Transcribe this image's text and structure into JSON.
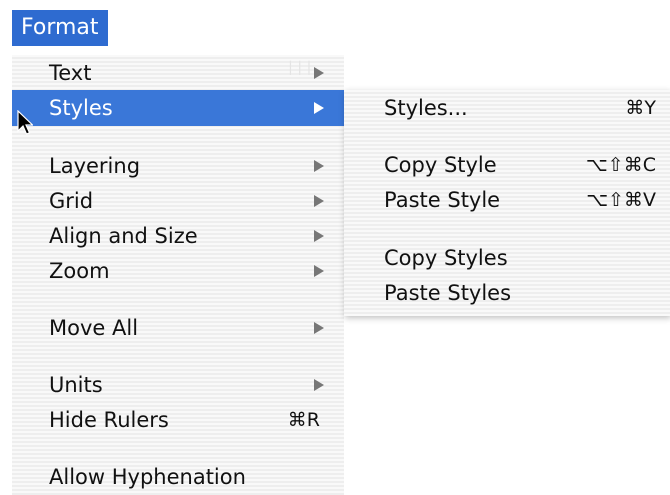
{
  "menubar": {
    "title": "Format"
  },
  "main_menu": {
    "items": [
      {
        "label": "Text",
        "submenu": true,
        "shortcut": ""
      },
      {
        "label": "Styles",
        "submenu": true,
        "shortcut": "",
        "selected": true
      },
      {
        "label": "Layering",
        "submenu": true,
        "shortcut": ""
      },
      {
        "label": "Grid",
        "submenu": true,
        "shortcut": ""
      },
      {
        "label": "Align and Size",
        "submenu": true,
        "shortcut": ""
      },
      {
        "label": "Zoom",
        "submenu": true,
        "shortcut": ""
      },
      {
        "label": "Move All",
        "submenu": true,
        "shortcut": ""
      },
      {
        "label": "Units",
        "submenu": true,
        "shortcut": ""
      },
      {
        "label": "Hide Rulers",
        "submenu": false,
        "shortcut": "⌘R"
      },
      {
        "label": "Allow Hyphenation",
        "submenu": false,
        "shortcut": ""
      }
    ]
  },
  "styles_submenu": {
    "items": [
      {
        "label": "Styles...",
        "shortcut": "⌘Y"
      },
      {
        "label": "Copy Style",
        "shortcut": "⌥⇧⌘C"
      },
      {
        "label": "Paste Style",
        "shortcut": "⌥⇧⌘V"
      },
      {
        "label": "Copy Styles",
        "shortcut": ""
      },
      {
        "label": "Paste Styles",
        "shortcut": ""
      }
    ]
  },
  "colors": {
    "highlight": "#3a77d8",
    "menubar_highlight": "#2e6bd0"
  }
}
